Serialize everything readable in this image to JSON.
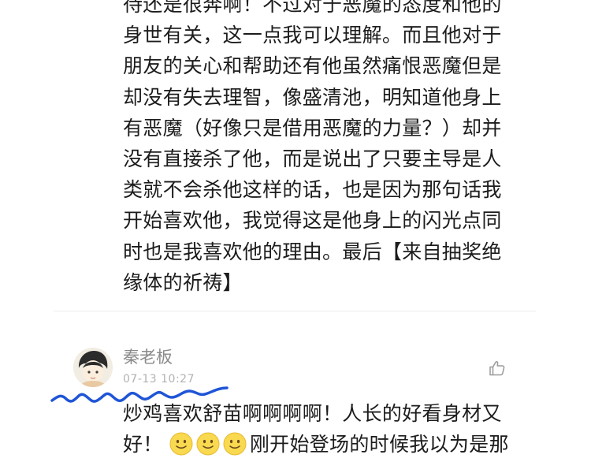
{
  "previous_comment": {
    "text": "待还是很奔啊！不过对于恶魔的态度和他的身世有关，这一点我可以理解。而且他对于朋友的关心和帮助还有他虽然痛恨恶魔但是却没有失去理智，像盛清池，明知道他身上有恶魔（好像只是借用恶魔的力量？）却并没有直接杀了他，而是说出了只要主导是人类就不会杀他这样的话，也是因为那句话我开始喜欢他，我觉得这是他身上的闪光点同时也是我喜欢他的理由。最后【来自抽奖绝缘体的祈祷】"
  },
  "comment": {
    "username": "秦老板",
    "timestamp": "07-13 10:27",
    "text_part1": "炒鸡喜欢舒苗啊啊啊啊！人长的好看身材又好！",
    "emoji_icon": "smiling-face-emoji",
    "text_part2": "刚开始登场的时候我以为是那",
    "like_icon": "thumbs-up-icon"
  },
  "colors": {
    "scribble": "#1f55d6",
    "meta_text": "#8a8a8a",
    "body_text": "#1c1c1c"
  }
}
